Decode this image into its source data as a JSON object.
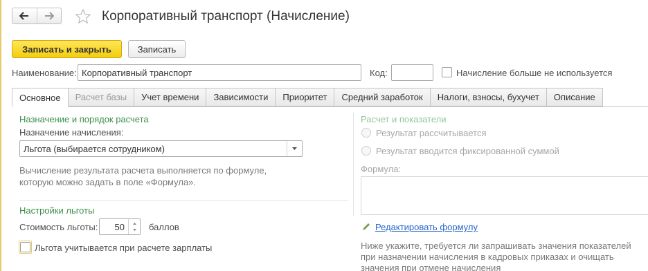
{
  "window": {
    "title": "Корпоративный транспорт (Начисление)"
  },
  "nav": {
    "back_icon": "arrow-left-icon",
    "forward_icon": "arrow-right-icon",
    "favorite_icon": "star-icon"
  },
  "toolbar": {
    "save_close_label": "Записать и закрыть",
    "save_label": "Записать"
  },
  "header_fields": {
    "name_label": "Наименование:",
    "name_value": "Корпоративный транспорт",
    "code_label": "Код:",
    "code_value": "",
    "unused_label": "Начисление больше не используется",
    "unused_checked": false
  },
  "tabs": [
    {
      "label": "Основное",
      "active": true,
      "disabled": false
    },
    {
      "label": "Расчет базы",
      "active": false,
      "disabled": true
    },
    {
      "label": "Учет времени",
      "active": false,
      "disabled": false
    },
    {
      "label": "Зависимости",
      "active": false,
      "disabled": false
    },
    {
      "label": "Приоритет",
      "active": false,
      "disabled": false
    },
    {
      "label": "Средний заработок",
      "active": false,
      "disabled": false
    },
    {
      "label": "Налоги, взносы, бухучет",
      "active": false,
      "disabled": false
    },
    {
      "label": "Описание",
      "active": false,
      "disabled": false
    }
  ],
  "left": {
    "purpose_section": "Назначение и порядок расчета",
    "purpose_label": "Назначение начисления:",
    "purpose_value": "Льгота (выбирается сотрудником)",
    "formula_note_line1": "Вычисление результата расчета выполняется по формуле,",
    "formula_note_line2": "которую можно задать в поле «Формула».",
    "benefit_section": "Настройки льготы",
    "cost_label": "Стоимость льготы:",
    "cost_value": "50",
    "cost_unit": "баллов",
    "salary_check_label": "Льгота учитывается при расчете зарплаты",
    "salary_checked": false
  },
  "right": {
    "section": "Расчет и показатели",
    "radio_calculated": "Результат рассчитывается",
    "radio_fixed": "Результат вводится фиксированной суммой",
    "formula_label": "Формула:",
    "formula_value": "",
    "edit_formula_link": "Редактировать формулу",
    "note_line1": "Ниже укажите, требуется ли запрашивать значения показателей",
    "note_line2": "при назначении начисления в кадровых приказах и очищать",
    "note_line3": "значения при отмене начисления"
  }
}
